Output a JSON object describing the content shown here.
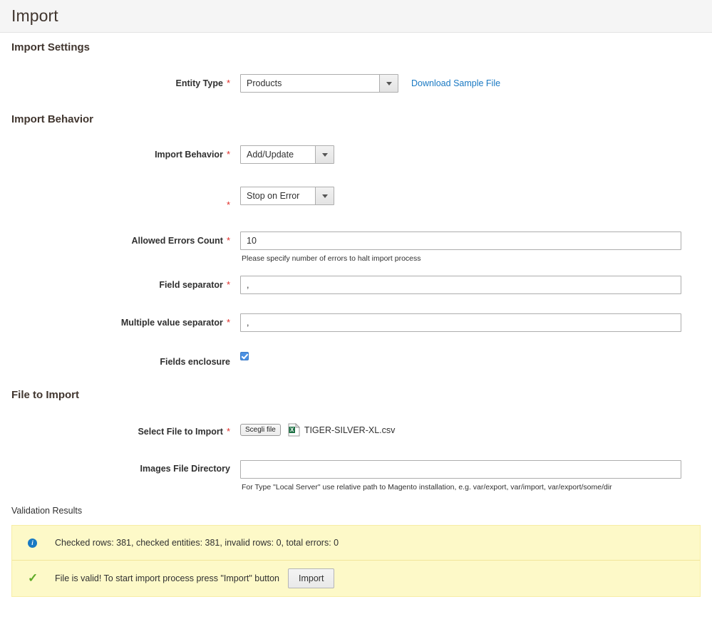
{
  "header": {
    "title": "Import"
  },
  "sections": {
    "import_settings": {
      "title": "Import Settings",
      "entity_type": {
        "label": "Entity Type",
        "required": "*",
        "value": "Products",
        "sample_link": "Download Sample File"
      }
    },
    "import_behavior": {
      "title": "Import Behavior",
      "behavior": {
        "label": "Import Behavior",
        "required": "*",
        "value": "Add/Update"
      },
      "error_strategy": {
        "label": "",
        "required": "*",
        "value": "Stop on Error"
      },
      "allowed_errors": {
        "label": "Allowed Errors Count",
        "required": "*",
        "value": "10",
        "helper": "Please specify number of errors to halt import process"
      },
      "field_separator": {
        "label": "Field separator",
        "required": "*",
        "value": ","
      },
      "multiple_value_separator": {
        "label": "Multiple value separator",
        "required": "*",
        "value": ","
      },
      "fields_enclosure": {
        "label": "Fields enclosure",
        "checked": true
      }
    },
    "file_to_import": {
      "title": "File to Import",
      "select_file": {
        "label": "Select File to Import",
        "required": "*",
        "button_label": "Scegli file",
        "file_name": "TIGER-SILVER-XL.csv",
        "file_icon": "csv-file-icon"
      },
      "images_directory": {
        "label": "Images File Directory",
        "value": "",
        "placeholder": "",
        "helper": "For Type \"Local Server\" use relative path to Magento installation, e.g. var/export, var/import, var/export/some/dir"
      }
    },
    "validation": {
      "label": "Validation Results",
      "info_message": "Checked rows: 381, checked entities: 381, invalid rows: 0, total errors: 0",
      "success_message": "File is valid! To start import process press \"Import\" button",
      "import_button": "Import",
      "info_icon": "info-circle-icon",
      "success_icon": "check-mark-icon"
    }
  },
  "colors": {
    "required_asterisk": "#e02b27",
    "link": "#1979c3",
    "heading": "#41362f",
    "notice_background": "#fdf9c8",
    "checkbox_accent": "#4a90e2",
    "success_check": "#5eaa26",
    "info_circle": "#1979c3"
  }
}
